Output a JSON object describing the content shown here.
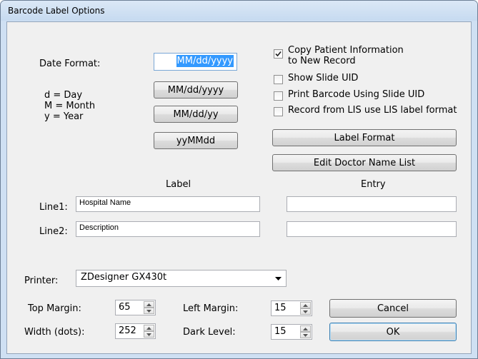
{
  "window": {
    "title": "Barcode Label Options"
  },
  "date_format": {
    "label": "Date Format:",
    "value": "MM/dd/yyyy",
    "legend": [
      "d = Day",
      "M = Month",
      "y = Year"
    ],
    "buttons": [
      "MM/dd/yyyy",
      "MM/dd/yy",
      "yyMMdd"
    ]
  },
  "options": {
    "copy_patient": {
      "label_line1": "Copy Patient Information",
      "label_line2": "to New Record",
      "checked": true
    },
    "show_slide_uid": {
      "label": "Show Slide UID",
      "checked": false
    },
    "print_barcode_uid": {
      "label": "Print Barcode Using Slide UID",
      "checked": false
    },
    "lis_label_format": {
      "label": "Record from LIS use LIS label format",
      "checked": false
    }
  },
  "actions": {
    "label_format": "Label Format",
    "edit_doctor_list": "Edit Doctor Name List"
  },
  "lines": {
    "label_header": "Label",
    "entry_header": "Entry",
    "rows": [
      {
        "name": "Line1:",
        "label": "Hospital Name",
        "entry": ""
      },
      {
        "name": "Line2:",
        "label": "Description",
        "entry": ""
      }
    ]
  },
  "printer": {
    "label": "Printer:",
    "value": "ZDesigner GX430t"
  },
  "margins": {
    "top_margin_label": "Top Margin:",
    "top_margin": "65",
    "width_label": "Width (dots):",
    "width": "252",
    "left_margin_label": "Left Margin:",
    "left_margin": "15",
    "dark_level_label": "Dark Level:",
    "dark_level": "15"
  },
  "dialog_buttons": {
    "cancel": "Cancel",
    "ok": "OK"
  }
}
